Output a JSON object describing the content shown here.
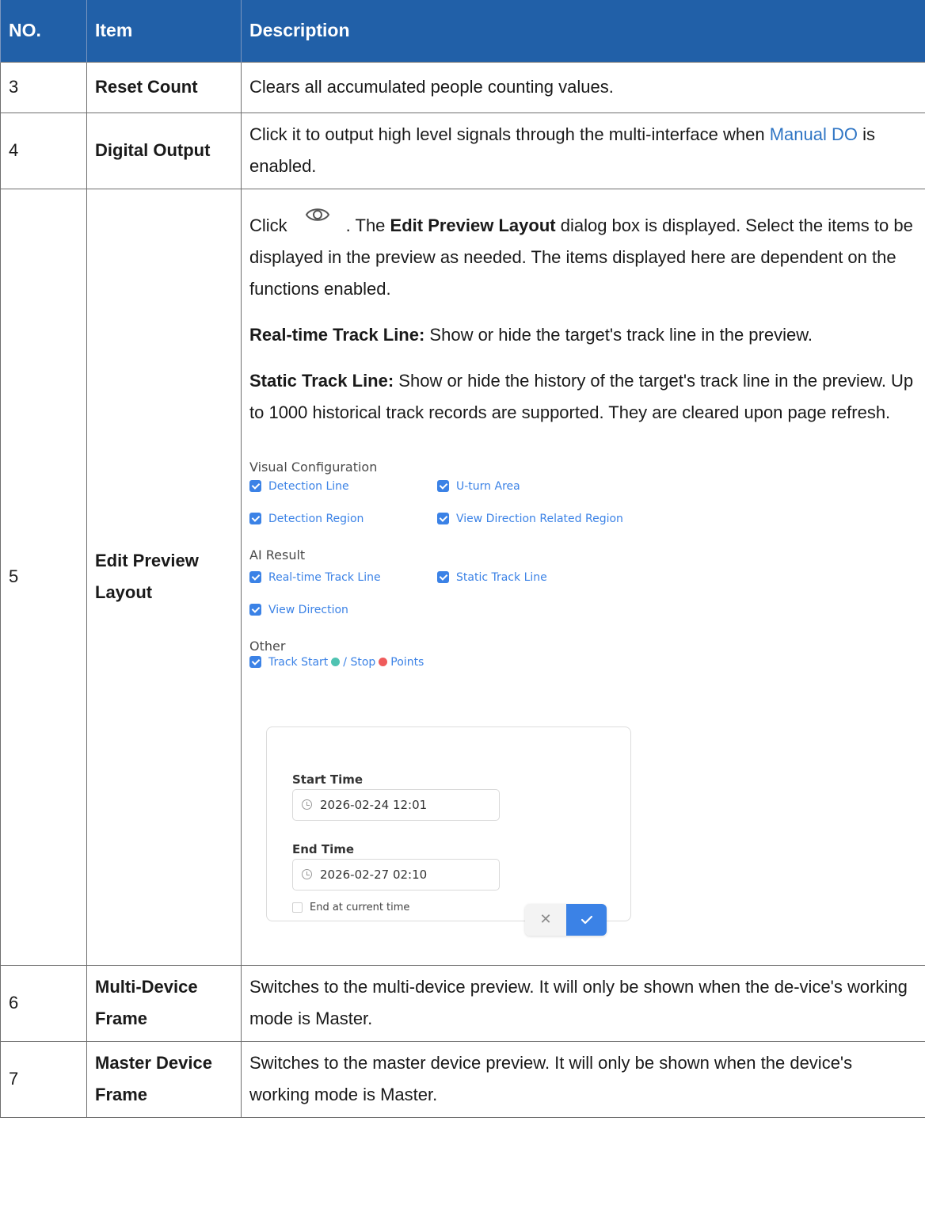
{
  "table": {
    "headers": [
      "NO.",
      "Item",
      "Description"
    ],
    "rows": [
      {
        "no": "3",
        "item": "Reset Count",
        "desc": "Clears all accumulated people counting values."
      },
      {
        "no": "4",
        "item": "Digital Output",
        "desc_before": "Click it to output high level signals through the multi-interface when ",
        "desc_link": "Manual DO",
        "desc_after": " is enabled."
      },
      {
        "no": "5",
        "item": "Edit Preview Layout",
        "p1_click": "Click",
        "p1_mid": ". The ",
        "p1_bold": "Edit Preview Layout",
        "p1_rest": " dialog box is displayed. Select the items to be displayed in the preview as needed. The items displayed here are dependent on the functions enabled.",
        "p2_bold": "Real-time Track Line:",
        "p2_rest": " Show or hide the target's track line in the preview.",
        "p3_bold": "Static Track Line:",
        "p3_rest": " Show or hide the history of the target's track line in the preview. Up to 1000 historical track records are supported. They are cleared upon page refresh.",
        "icon": "eye-icon"
      },
      {
        "no": "6",
        "item": "Multi-Device Frame",
        "desc": "Switches to the multi-device preview. It will only be shown when the de-vice's working mode is Master."
      },
      {
        "no": "7",
        "item": "Master Device Frame",
        "desc": "Switches to the master device preview. It will only be shown when the device's working mode is Master."
      }
    ]
  },
  "screenshot": {
    "visual_heading": "Visual Configuration",
    "detection_line": "Detection Line",
    "u_turn_area": "U-turn Area",
    "detection_region": "Detection Region",
    "view_direction_region": "View Direction Related Region",
    "ai_heading": "AI Result",
    "realtime_track": "Real-time Track Line",
    "static_track": "Static Track Line",
    "view_direction": "View Direction",
    "other_heading": "Other",
    "track_start": "Track Start",
    "stop": "/ Stop",
    "points": "Points",
    "start_time_label": "Start Time",
    "start_time_value": "2026-02-24 12:01",
    "end_time_label": "End Time",
    "end_time_value": "2026-02-27 02:10",
    "end_now_label": "End at current time",
    "colors": {
      "accent": "#3b82e6",
      "start_dot": "#4fc3b2",
      "stop_dot": "#ef5b5b",
      "header_bg": "#2160a8"
    },
    "icons": {
      "checkbox": "checkbox-checked-icon",
      "clock": "clock-icon",
      "cancel": "close-icon",
      "confirm": "check-icon"
    }
  }
}
